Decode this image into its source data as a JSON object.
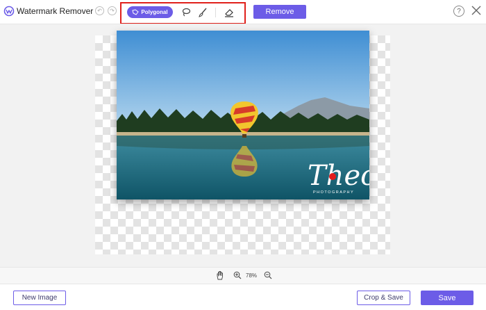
{
  "app": {
    "title": "Watermark Remover"
  },
  "toolbar": {
    "undo_icon": "undo-icon",
    "redo_icon": "redo-icon",
    "polygonal_label": "Polygonal",
    "lasso_icon": "lasso-icon",
    "brush_icon": "brush-icon",
    "eraser_icon": "eraser-icon",
    "remove_label": "Remove",
    "help_label": "?",
    "accent_color": "#6c5ce7",
    "highlight_color": "#e0201b"
  },
  "canvas": {
    "watermark_text": "Theo",
    "watermark_subtext": "PHOTOGRAPHY"
  },
  "zoom": {
    "value": "78%"
  },
  "footer": {
    "new_image_label": "New Image",
    "crop_save_label": "Crop & Save",
    "save_label": "Save"
  }
}
